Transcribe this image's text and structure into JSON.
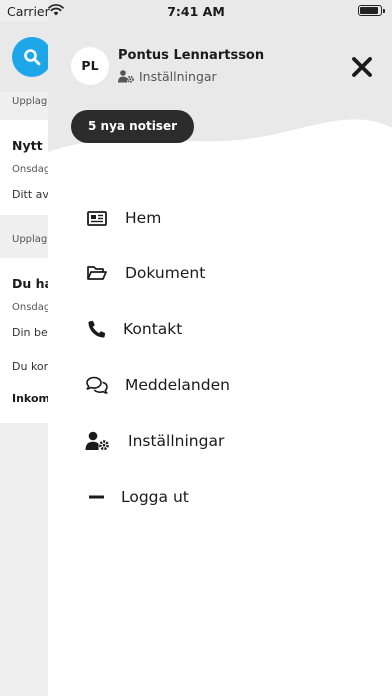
{
  "status_bar": {
    "carrier": "Carrier",
    "time": "7:41 AM"
  },
  "background_feed": {
    "items": [
      {
        "meta": "Upplag"
      },
      {
        "title": "Nytt",
        "date": "Onsdag",
        "text": "Ditt av"
      },
      {
        "meta": "Upplag"
      },
      {
        "title": "Du ha",
        "date": "Onsdag",
        "text": "Din be",
        "text2": "Du kor",
        "text3": "Inkom"
      }
    ]
  },
  "drawer": {
    "avatar_initials": "PL",
    "user_name": "Pontus Lennartsson",
    "settings_label": "Inställningar",
    "notifications_label": "5 nya notiser",
    "menu": [
      {
        "label": "Hem",
        "icon": "news-icon"
      },
      {
        "label": "Dokument",
        "icon": "folder-icon"
      },
      {
        "label": "Kontakt",
        "icon": "phone-icon"
      },
      {
        "label": "Meddelanden",
        "icon": "chat-icon"
      },
      {
        "label": "Inställningar",
        "icon": "user-settings-icon"
      },
      {
        "label": "Logga ut",
        "icon": "minus-icon"
      }
    ]
  },
  "colors": {
    "accent": "#1ea7e8",
    "badge_bg": "#2c2c2c",
    "header_bg": "#e9e9e9"
  }
}
